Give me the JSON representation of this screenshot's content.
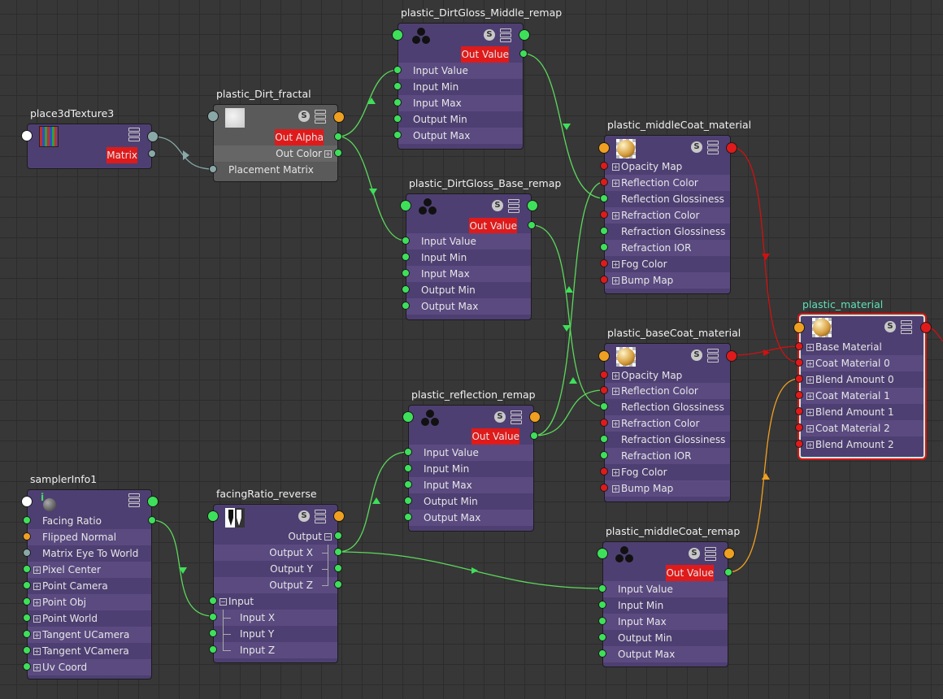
{
  "colors": {
    "background": "#373737",
    "node_body": "#4e3f72",
    "node_row_alt": "#5a4a80",
    "plug_green": "#3ee05a",
    "plug_orange": "#f0a020",
    "plug_red": "#e01a1a",
    "selection_outline": "#e01010",
    "selected_title": "#5fe0b8"
  },
  "header_buttons": {
    "swatch_toggle": "S"
  },
  "nodes": {
    "place3dTexture3": {
      "title": "place3dTexture3",
      "thumbnail_icon": "place3d-texture-icon",
      "outputs": [
        "Matrix"
      ]
    },
    "dirt_fractal": {
      "title": "plastic_Dirt_fractal",
      "thumbnail_icon": "fractal-texture-icon",
      "outputs": [
        "Out Alpha",
        "Out Color"
      ],
      "inputs": [
        "Placement Matrix"
      ]
    },
    "middle_remap": {
      "title": "plastic_DirtGloss_Middle_remap",
      "thumbnail_icon": "remap-value-icon",
      "output": "Out Value",
      "inputs": [
        "Input Value",
        "Input Min",
        "Input Max",
        "Output Min",
        "Output Max"
      ]
    },
    "base_remap": {
      "title": "plastic_DirtGloss_Base_remap",
      "thumbnail_icon": "remap-value-icon",
      "output": "Out Value",
      "inputs": [
        "Input Value",
        "Input Min",
        "Input Max",
        "Output Min",
        "Output Max"
      ]
    },
    "middle_coat_material": {
      "title": "plastic_middleCoat_material",
      "thumbnail_icon": "material-sphere-icon",
      "inputs": [
        "Opacity Map",
        "Reflection Color",
        "Reflection Glossiness",
        "Refraction Color",
        "Refraction Glossiness",
        "Refraction IOR",
        "Fog Color",
        "Bump Map"
      ]
    },
    "base_coat_material": {
      "title": "plastic_baseCoat_material",
      "thumbnail_icon": "material-sphere-icon",
      "inputs": [
        "Opacity Map",
        "Reflection Color",
        "Reflection Glossiness",
        "Refraction Color",
        "Refraction Glossiness",
        "Refraction IOR",
        "Fog Color",
        "Bump Map"
      ]
    },
    "plastic_material": {
      "title": "plastic_material",
      "thumbnail_icon": "material-sphere-icon",
      "inputs": [
        "Base Material",
        "Coat Material 0",
        "Blend Amount 0",
        "Coat Material 1",
        "Blend Amount 1",
        "Coat Material 2",
        "Blend Amount 2"
      ]
    },
    "reflection_remap": {
      "title": "plastic_reflection_remap",
      "thumbnail_icon": "remap-value-icon",
      "output": "Out Value",
      "inputs": [
        "Input Value",
        "Input Min",
        "Input Max",
        "Output Min",
        "Output Max"
      ]
    },
    "sampler_info": {
      "title": "samplerInfo1",
      "thumbnail_icon": "sampler-info-icon",
      "outputs": [
        "Facing Ratio",
        "Flipped Normal",
        "Matrix Eye To World",
        "Pixel Center",
        "Point Camera",
        "Point Obj",
        "Point World",
        "Tangent UCamera",
        "Tangent VCamera",
        "Uv Coord"
      ]
    },
    "facing_reverse": {
      "title": "facingRatio_reverse",
      "thumbnail_icon": "reverse-icon",
      "outputs": [
        "Output",
        "Output X",
        "Output Y",
        "Output Z"
      ],
      "inputs": [
        "Input",
        "Input X",
        "Input Y",
        "Input Z"
      ]
    },
    "middle_coat_remap": {
      "title": "plastic_middleCoat_remap",
      "thumbnail_icon": "remap-value-icon",
      "output": "Out Value",
      "inputs": [
        "Input Value",
        "Input Min",
        "Input Max",
        "Output Min",
        "Output Max"
      ]
    }
  }
}
